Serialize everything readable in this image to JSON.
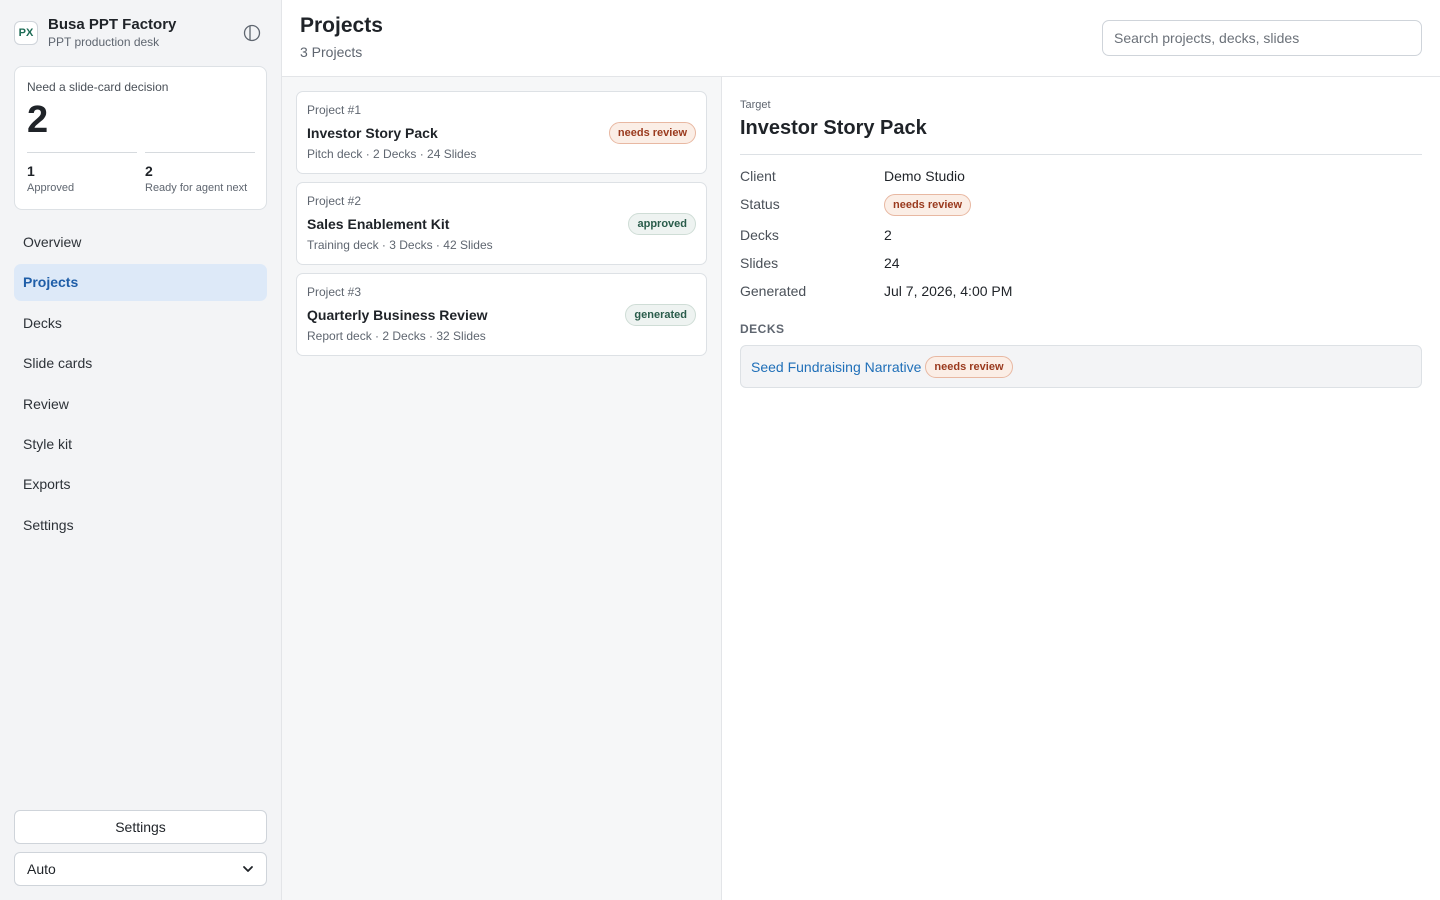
{
  "brand": {
    "logo_text": "PX",
    "name": "Busa PPT Factory",
    "subtitle": "PPT production desk",
    "toggle_icon": "sidebar-toggle-icon"
  },
  "decision": {
    "label": "Need a slide-card decision",
    "count": "2",
    "stats": [
      {
        "value": "1",
        "label": "Approved"
      },
      {
        "value": "2",
        "label": "Ready for agent next"
      }
    ]
  },
  "nav": {
    "active": "Projects",
    "items": [
      "Overview",
      "Projects",
      "Decks",
      "Slide cards",
      "Review",
      "Style kit",
      "Exports",
      "Settings"
    ]
  },
  "footer": {
    "settings_label": "Settings",
    "theme_value": "Auto"
  },
  "header": {
    "title": "Projects",
    "subtitle": "3 Projects",
    "search_placeholder": "Search projects, decks, slides"
  },
  "projects": [
    {
      "number": "Project #1",
      "name": "Investor Story Pack",
      "meta": "Pitch deck · 2 Decks · 24 Slides",
      "status": "needs review"
    },
    {
      "number": "Project #2",
      "name": "Sales Enablement Kit",
      "meta": "Training deck · 3 Decks · 42 Slides",
      "status": "approved"
    },
    {
      "number": "Project #3",
      "name": "Quarterly Business Review",
      "meta": "Report deck · 2 Decks · 32 Slides",
      "status": "generated"
    }
  ],
  "detail": {
    "eyebrow": "Target",
    "title": "Investor Story Pack",
    "fields": {
      "client_label": "Client",
      "client": "Demo Studio",
      "status_label": "Status",
      "status": "needs review",
      "decks_label": "Decks",
      "decks": "2",
      "slides_label": "Slides",
      "slides": "24",
      "generated_label": "Generated",
      "generated": "Jul 7, 2026, 4:00 PM"
    },
    "decks_heading": "DECKS",
    "decks_list": [
      {
        "name": "Seed Fundraising Narrative",
        "status": "needs review"
      }
    ]
  },
  "colors": {
    "accent": "#1f5ea8",
    "link": "#1f6fb8",
    "review_badge": "#9a3a1e",
    "approved_badge": "#2a5c4b"
  }
}
